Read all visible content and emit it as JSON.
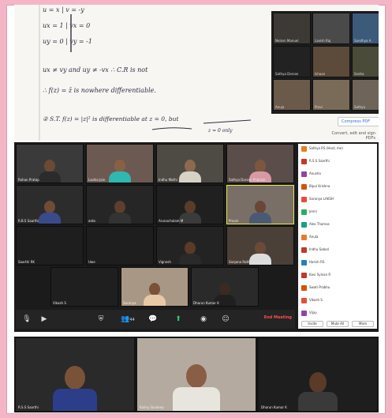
{
  "whiteboard": {
    "lines": [
      "u = x    |   v = -y",
      "ux = 1   |   vx = 0",
      "uy = 0   |   vy = -1",
      "ux ≠ vy   and  uy ≠ -vx  ∴ C.R is not",
      "∴ f(z) = z̄  is nowhere differentiable.",
      "② S.T.  f(z) = |z|²  is differentiable at z = 0, but",
      "z = 0 only"
    ]
  },
  "whiteboard_side": {
    "pdf_label": "Compress PDF",
    "hint_label": "Convert, edit and sign PDFs"
  },
  "gallery_top": [
    "Nelson Manuel",
    "Lavish Raj",
    "Sandhya A.",
    "Sathya Darsan",
    "Ishaan",
    "Sneha",
    "Anuja",
    "Pravi",
    "Sathya",
    "Kailey"
  ],
  "gallery_main": [
    "Rohan Pratap",
    "Lavika Jain",
    "Indhu Mathi",
    "Sathya Darsan Prakash",
    "R.B.S Saarthi",
    "anto",
    "Arunachalam M",
    "Pravin",
    "Saarthi RK",
    "Uwe",
    "Vignesh",
    "Sanjana Rath",
    "Vikash S",
    "Saranya",
    "Dharun Kumar K"
  ],
  "toolbar": {
    "end_label": "End Meeting",
    "participants_count": "44"
  },
  "participants": [
    "Sathya RS (Host, me)",
    "R.S.S Saarthi",
    "Anusha",
    "Bipul Krishna",
    "Saranya LAKSH",
    "Jenni",
    "Alex Thomas",
    "Anula",
    "Indhu Sabari",
    "Harish RS",
    "Kavi Sylvan R",
    "Swati Prabhu",
    "Vikash S",
    "Vijay"
  ],
  "participants_buttons": [
    "Invite",
    "Mute All",
    "More"
  ],
  "bottom_strip": [
    "R.S.S Saarthi",
    "Kailey Sandeep",
    "Dharun Kumar K"
  ],
  "colors": {
    "accent": "#e6e64a",
    "end": "#ff4d4d",
    "bg": "#f4b6c7"
  }
}
